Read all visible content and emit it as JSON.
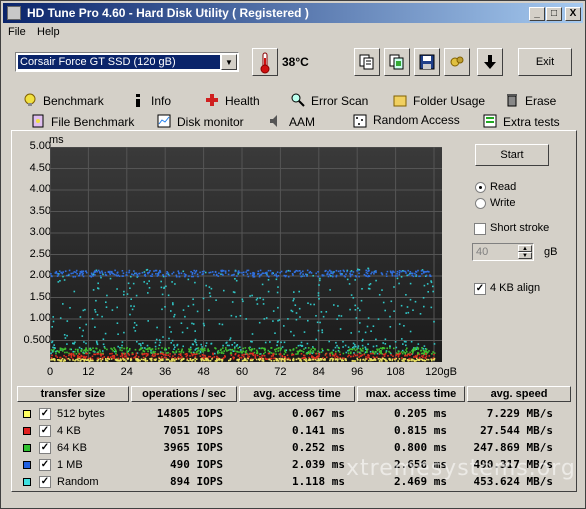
{
  "window": {
    "title": "HD Tune Pro 4.60 - Hard Disk Utility (  Registered )"
  },
  "titlebar_buttons": {
    "minimize": "_",
    "maximize": "□",
    "close": "X"
  },
  "menu": [
    "File",
    "Help"
  ],
  "toolbar": {
    "drive": "Corsair Force GT SSD     (120 gB)",
    "temperature": "38°C",
    "exit": "Exit",
    "icons": [
      "copy-text-icon",
      "copy-screenshot-icon",
      "save-icon",
      "options-icon",
      "download-icon"
    ]
  },
  "tabs_row1": [
    {
      "label": "Benchmark",
      "icon": "bulb-icon"
    },
    {
      "label": "Info",
      "icon": "info-icon"
    },
    {
      "label": "Health",
      "icon": "health-cross-icon"
    },
    {
      "label": "Error Scan",
      "icon": "magnifier-icon"
    },
    {
      "label": "Folder Usage",
      "icon": "folder-icon"
    },
    {
      "label": "Erase",
      "icon": "trash-icon"
    }
  ],
  "tabs_row2": [
    {
      "label": "File Benchmark",
      "icon": "file-benchmark-icon"
    },
    {
      "label": "Disk monitor",
      "icon": "disk-monitor-icon"
    },
    {
      "label": "AAM",
      "icon": "speaker-icon"
    },
    {
      "label": "Random Access",
      "icon": "random-access-icon",
      "active": true
    },
    {
      "label": "Extra tests",
      "icon": "extra-tests-icon"
    }
  ],
  "controls": {
    "start": "Start",
    "read": "Read",
    "write": "Write",
    "read_selected": true,
    "short_stroke": "Short stroke",
    "short_stroke_checked": false,
    "stroke_value": "40",
    "stroke_unit": "gB",
    "align": "4 KB align",
    "align_checked": true
  },
  "chart_data": {
    "type": "scatter",
    "ylabel": "ms",
    "y_ticks": [
      "5.00",
      "4.50",
      "4.00",
      "3.50",
      "3.00",
      "2.50",
      "2.00",
      "1.50",
      "1.00",
      "0.500"
    ],
    "x_ticks": [
      "0",
      "12",
      "24",
      "36",
      "48",
      "60",
      "72",
      "84",
      "96",
      "108",
      "120gB"
    ],
    "xlim": [
      0,
      120
    ],
    "ylim": [
      0,
      5
    ],
    "grid": true,
    "series": [
      {
        "name": "512 bytes",
        "color": "#e8e060",
        "band": [
          0.04,
          0.1
        ]
      },
      {
        "name": "4 KB",
        "color": "#e03020",
        "band": [
          0.08,
          0.22
        ]
      },
      {
        "name": "64 KB",
        "color": "#40c030",
        "band": [
          0.2,
          0.35
        ]
      },
      {
        "name": "1 MB",
        "color": "#3070e0",
        "band": [
          2.0,
          2.15
        ]
      },
      {
        "name": "Random",
        "color": "#30c8c8",
        "band": [
          0.2,
          2.2
        ]
      }
    ]
  },
  "table": {
    "headers": [
      "transfer size",
      "operations / sec",
      "avg. access time",
      "max. access time",
      "avg. speed"
    ],
    "rows": [
      {
        "size": "512 bytes",
        "ops": "14805 IOPS",
        "avg": "0.067 ms",
        "max": "0.205 ms",
        "speed": "7.229 MB/s",
        "color": "#ffff60"
      },
      {
        "size": "4 KB",
        "ops": "7051 IOPS",
        "avg": "0.141 ms",
        "max": "0.815 ms",
        "speed": "27.544 MB/s",
        "color": "#e02020"
      },
      {
        "size": "64 KB",
        "ops": "3965 IOPS",
        "avg": "0.252 ms",
        "max": "0.800 ms",
        "speed": "247.869 MB/s",
        "color": "#30c030"
      },
      {
        "size": "1 MB",
        "ops": "490 IOPS",
        "avg": "2.039 ms",
        "max": "2.656 ms",
        "speed": "490.317 MB/s",
        "color": "#2060e0"
      },
      {
        "size": "Random",
        "ops": "894 IOPS",
        "avg": "1.118 ms",
        "max": "2.469 ms",
        "speed": "453.624 MB/s",
        "color": "#40e0e0"
      }
    ]
  },
  "watermark": "xtremesystems.org"
}
